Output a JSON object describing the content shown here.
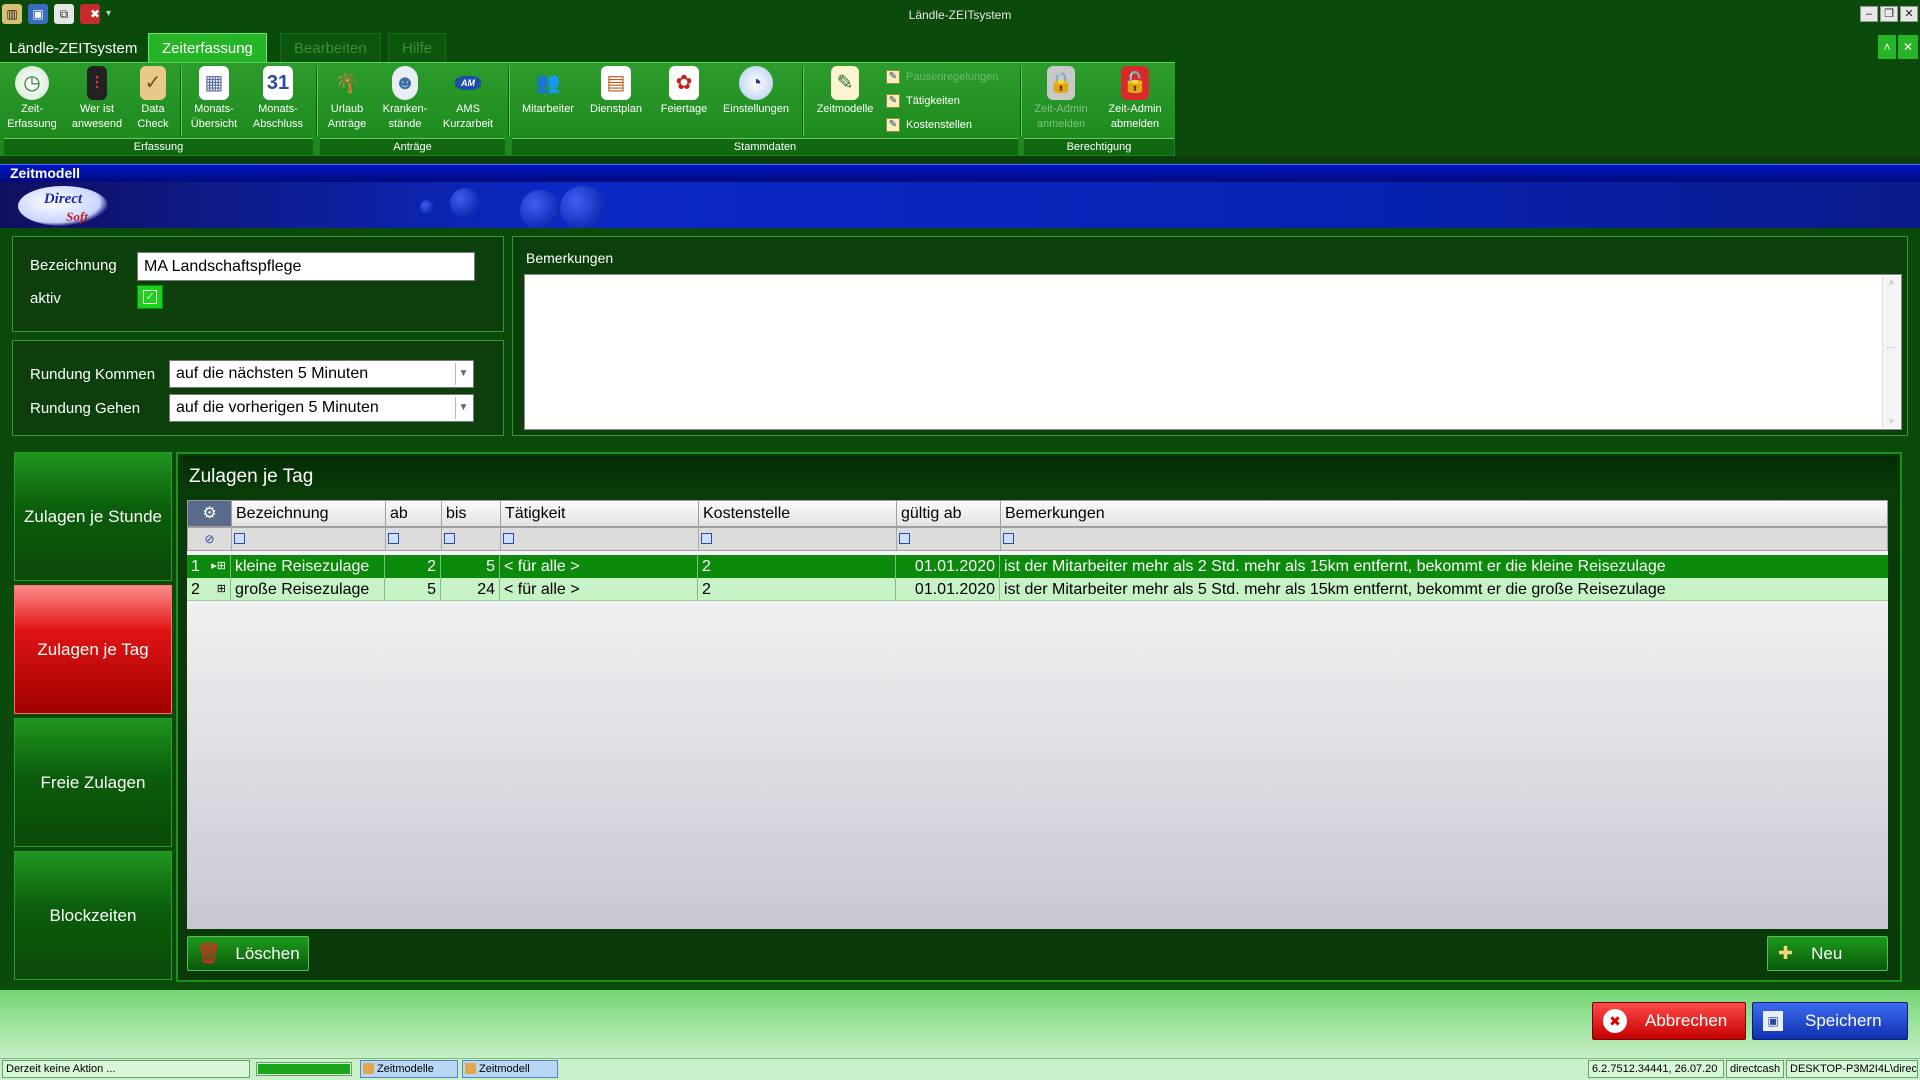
{
  "app": {
    "title": "Ländle-ZEITsystem"
  },
  "tabs": [
    {
      "label": "Ländle-ZEITsystem"
    },
    {
      "label": "Zeiterfassung"
    },
    {
      "label": "Bearbeiten"
    },
    {
      "label": "Hilfe"
    }
  ],
  "ribbon": {
    "groups": [
      "Erfassung",
      "Anträge",
      "Stammdaten",
      "Berechtigung"
    ],
    "buttons": [
      {
        "l1": "Zeit-",
        "l2": "Erfassung"
      },
      {
        "l1": "Wer ist",
        "l2": "anwesend"
      },
      {
        "l1": "Data",
        "l2": "Check"
      },
      {
        "l1": "Monats-",
        "l2": "Übersicht"
      },
      {
        "l1": "Monats-",
        "l2": "Abschluss"
      },
      {
        "l1": "Urlaub",
        "l2": "Anträge"
      },
      {
        "l1": "Kranken-",
        "l2": "stände"
      },
      {
        "l1": "AMS",
        "l2": "Kurzarbeit"
      },
      {
        "l1": "Mitarbeiter",
        "l2": ""
      },
      {
        "l1": "Dienstplan",
        "l2": ""
      },
      {
        "l1": "Feiertage",
        "l2": ""
      },
      {
        "l1": "Einstellungen",
        "l2": ""
      },
      {
        "l1": "Zeitmodelle",
        "l2": ""
      },
      {
        "l1": "Zeit-Admin",
        "l2": "anmelden"
      },
      {
        "l1": "Zeit-Admin",
        "l2": "abmelden"
      }
    ],
    "small_items": [
      "Pausenregelungen",
      "Tätigkeiten",
      "Kostenstellen"
    ],
    "ams_badge": "AM"
  },
  "form": {
    "title": "Zeitmodell",
    "logo": {
      "l1": "Direct",
      "l2": "Soft"
    },
    "bezeichnung_label": "Bezeichnung",
    "bezeichnung_value": "MA Landschaftspflege",
    "aktiv_label": "aktiv",
    "aktiv_checked": true,
    "rundung_kommen_label": "Rundung Kommen",
    "rundung_kommen_value": "auf die nächsten 5 Minuten",
    "rundung_gehen_label": "Rundung Gehen",
    "rundung_gehen_value": "auf die vorherigen 5 Minuten",
    "bemerkungen_label": "Bemerkungen",
    "bemerkungen_value": ""
  },
  "side_tabs": [
    "Zulagen je Stunde",
    "Zulagen je Tag",
    "Freie Zulagen",
    "Blockzeiten"
  ],
  "grid": {
    "title": "Zulagen je Tag",
    "columns": [
      "Bezeichnung",
      "ab",
      "bis",
      "Tätigkeit",
      "Kostenstelle",
      "gültig ab",
      "Bemerkungen"
    ],
    "rows": [
      {
        "nr": "1",
        "bezeichnung": "kleine Reisezulage",
        "ab": "2",
        "bis": "5",
        "taetigkeit": "< für alle >",
        "kostenstelle": "2",
        "gueltig_ab": "01.01.2020",
        "bemerkungen": "ist der Mitarbeiter mehr als 2 Std. mehr als 15km entfernt, bekommt er die kleine Reisezulage"
      },
      {
        "nr": "2",
        "bezeichnung": "große Reisezulage",
        "ab": "5",
        "bis": "24",
        "taetigkeit": "< für alle >",
        "kostenstelle": "2",
        "gueltig_ab": "01.01.2020",
        "bemerkungen": "ist der Mitarbeiter mehr als 5 Std. mehr als 15km entfernt, bekommt er die große Reisezulage"
      }
    ],
    "delete_label": "Löschen",
    "new_label": "Neu"
  },
  "footer": {
    "cancel_label": "Abbrechen",
    "save_label": "Speichern"
  },
  "statusbar": {
    "message": "Derzeit keine Aktion ...",
    "window1": "Zeitmodelle",
    "window2": "Zeitmodell",
    "version": "6.2.7512.34441, 26.07.20",
    "db": "directcash",
    "user": "DESKTOP-P3M2I4L\\direc"
  },
  "colors": {
    "accent_green": "#1d8f1d",
    "selected_row": "#0b8a0b",
    "alt_row": "#c6f2c6",
    "cancel": "#e01414",
    "save": "#1a36c8"
  }
}
